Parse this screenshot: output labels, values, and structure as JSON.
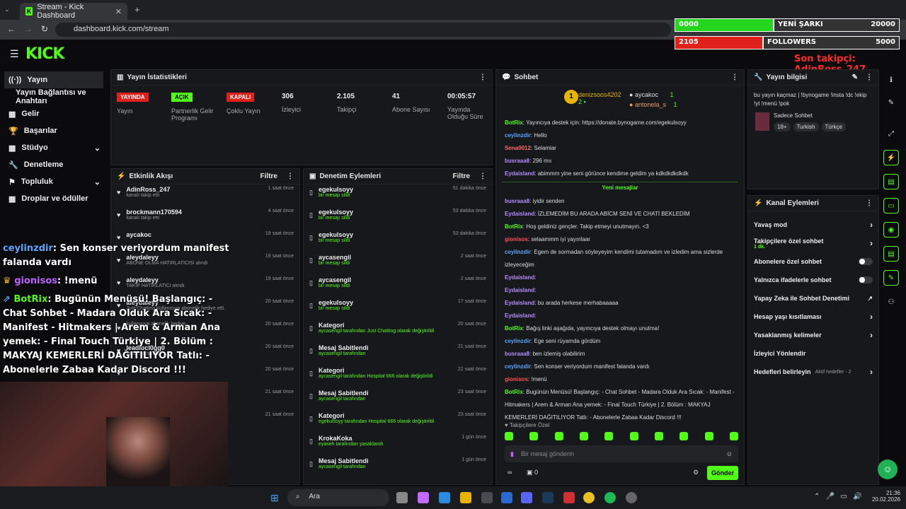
{
  "browser": {
    "tab_title": "Stream - Kick Dashboard",
    "url": "dashboard.kick.com/stream"
  },
  "overlay": {
    "bar1_left": "0000",
    "bar1_mid": "YENİ ŞARKI",
    "bar1_right": "20000",
    "bar2_left": "2105",
    "bar2_mid": "FOLLOWERS",
    "bar2_right": "5000",
    "last_follower": "Son takipçi: AdinRoss_247"
  },
  "brand": {
    "logo": "KICK",
    "accent": "#53fc18"
  },
  "sidebar": {
    "items": [
      {
        "label": "Yayın",
        "icon": "broadcast-icon"
      },
      {
        "label": "Yayın Bağlantısı ve Anahtarı",
        "icon": ""
      },
      {
        "label": "Gelir",
        "icon": "grid-icon"
      },
      {
        "label": "Başarılar",
        "icon": "trophy-icon"
      },
      {
        "label": "Stüdyo",
        "icon": "grid-icon"
      },
      {
        "label": "Denetleme",
        "icon": "wrench-icon"
      },
      {
        "label": "Topluluk",
        "icon": "people-icon"
      },
      {
        "label": "Droplar ve ödüller",
        "icon": "grid-icon"
      }
    ]
  },
  "stats": {
    "title": "Yayın İstatistikleri",
    "live_badge": "YAYINDA",
    "live_label": "Yayın",
    "partner_badge": "AÇIK",
    "partner_label": "Partnerlik Gelir Programı",
    "multi_badge": "KAPALI",
    "multi_label": "Çoklu Yayın",
    "viewers": "306",
    "viewers_label": "İzleyici",
    "followers": "2.105",
    "followers_label": "Takipçi",
    "subs": "41",
    "subs_label": "Abone Sayısı",
    "uptime": "00:05:57",
    "uptime_label": "Yayında Olduğu Süre"
  },
  "activity": {
    "title": "Etkinlik Akışı",
    "filter": "Filtre",
    "rows": [
      {
        "name": "AdinRoss_247",
        "sub": "kanalı takip etti",
        "time": "1 saat önce"
      },
      {
        "name": "brockmann170594",
        "sub": "kanalı takip etti",
        "time": "4 saat önce"
      },
      {
        "name": "aycakoc",
        "sub": "",
        "time": "19 saat önce"
      },
      {
        "name": "aleydaleyy",
        "sub": "ABONE OLMA HATIRLATICISI alındı",
        "time": "19 saat önce"
      },
      {
        "name": "aleydaleyy",
        "sub": "TAKİP HATIRLATICI alındı",
        "time": "19 saat önce"
      },
      {
        "name": "aleydaleyy",
        "sub": "Just Chatting kullanıcıya abonelik hediye etti.",
        "time": "20 saat önce"
      },
      {
        "name": "",
        "sub": "kullanıcıya abonelik hediye",
        "time": "20 saat önce"
      },
      {
        "name": "leadlocl0gg0",
        "sub": "kanalı takip etti",
        "time": "20 saat önce"
      },
      {
        "name": "",
        "sub": "",
        "time": "20 saat önce"
      },
      {
        "name": "",
        "sub": "",
        "time": "21 saat önce"
      },
      {
        "name": "",
        "sub": "",
        "time": "21 saat önce"
      }
    ]
  },
  "moderation": {
    "title": "Denetim Eylemleri",
    "filter": "Filtre",
    "rows": [
      {
        "name": "egekulsoyy",
        "sub": "bir mesajı sildi",
        "time": "51 dakika önce"
      },
      {
        "name": "egekulsoyy",
        "sub": "bir mesajı sildi",
        "time": "53 dakika önce"
      },
      {
        "name": "egekulsoyy",
        "sub": "bir mesajı sildi",
        "time": "53 dakika önce"
      },
      {
        "name": "aycasengil",
        "sub": "bir mesajı sildi",
        "time": "2 saat önce"
      },
      {
        "name": "aycasengil",
        "sub": "bir mesajı sildi",
        "time": "2 saat önce"
      },
      {
        "name": "egekulsoyy",
        "sub": "bir mesajı sildi",
        "time": "17 saat önce"
      },
      {
        "name": "Kategori",
        "sub": "aycasengil tarafından Just Chatting olarak değiştirildi",
        "time": "20 saat önce"
      },
      {
        "name": "Mesaj Sabitlendi",
        "sub": "aycasengil tarafından",
        "time": "21 saat önce"
      },
      {
        "name": "Kategori",
        "sub": "aycasengil tarafından Hospital 666 olarak değiştirildi",
        "time": "21 saat önce"
      },
      {
        "name": "Mesaj Sabitlendi",
        "sub": "aycasengil tarafından",
        "time": "23 saat önce"
      },
      {
        "name": "Kategori",
        "sub": "egekulsoyy tarafından Hospital 666 olarak değiştirildi",
        "time": "23 saat önce"
      },
      {
        "name": "KrokaKoka",
        "sub": "eyaseh tarafından yasaklandı",
        "time": "1 gün önce"
      },
      {
        "name": "Mesaj Sabitlendi",
        "sub": "aycasengil tarafından",
        "time": "1 gün önce"
      }
    ]
  },
  "chat": {
    "title": "Sohbet",
    "top1_name": "denizsoos4202",
    "top1_count": "2",
    "top2_name": "aycakoc",
    "top2_count": "1",
    "top3_name": "antonela_s",
    "top3_count": "1",
    "new_messages": "Yeni mesajlar",
    "messages": [
      {
        "user": "BotRix",
        "color": "#53fc18",
        "text": "Yayıncıya destek için: https://donate.bynogame.com/egekulsoyy"
      },
      {
        "user": "ceylinzdir",
        "color": "#5aa7ff",
        "text": "Hello"
      },
      {
        "user": "Sena0012",
        "color": "#ff6a6a",
        "text": "Selamlar"
      },
      {
        "user": "busraaa8",
        "color": "#b58cff",
        "text": "296 mıı"
      },
      {
        "user": "Eydaisland",
        "color": "#b58cff",
        "text": "abimmm yine seni görünce kendime geldim ya kdkdkdkdkdk"
      },
      {
        "user": "busraaa8",
        "color": "#b58cff",
        "text": "iyidir senden"
      },
      {
        "user": "Eydaisland",
        "color": "#b58cff",
        "text": "İZLEMEDİM BU ARADA ABİCM SENİ VE CHATİ BEKLEDİM"
      },
      {
        "user": "BotRix",
        "color": "#53fc18",
        "text": "Hoş geldiniz gençler. Takip etmeyi unutmayın. <3"
      },
      {
        "user": "gionisos",
        "color": "#ff5050",
        "text": "selaammm iyi yayınlaar"
      },
      {
        "user": "ceylinzdir",
        "color": "#5aa7ff",
        "text": "Egem de sormadan söyleyeyim kendimi tutamadım ve izledim ama sizlerde izleyeceğim"
      },
      {
        "user": "Eydaisland",
        "color": "#b58cff",
        "text": ""
      },
      {
        "user": "Eydaisland",
        "color": "#b58cff",
        "text": ""
      },
      {
        "user": "Eydaisland",
        "color": "#b58cff",
        "text": "bu arada herkese merhabaaaaa"
      },
      {
        "user": "Eydaisland",
        "color": "#b58cff",
        "text": ""
      },
      {
        "user": "BotRix",
        "color": "#53fc18",
        "text": "Bağış linki aşağıda, yayıncıya destek olmayı unutma!"
      },
      {
        "user": "ceylinzdir",
        "color": "#5aa7ff",
        "text": "Ege seni rüyamda gördüm"
      },
      {
        "user": "busraaa8",
        "color": "#b58cff",
        "text": "ben izlemiş olabilirim"
      },
      {
        "user": "ceylinzdir",
        "color": "#5aa7ff",
        "text": "Sen konser veriyordum manifest falanda vardı"
      },
      {
        "user": "gionisos",
        "color": "#ff5050",
        "text": "!menü"
      },
      {
        "user": "BotRix",
        "color": "#53fc18",
        "text": "Bugünün Menüsü! Başlangıç: - Chat Sohbet - Madara Olduk Ara Sıcak: - Manifest - Hitmakers | Arem & Arman Ana yemek: - Final Touch Türkiye | 2. Bölüm : MAKYAJ KEMERLERİ DAĞITILIYOR Tatlı: - Abonelerle Zabaa Kadar Discord !!!"
      }
    ],
    "subs_only": "Takipçilere Özel",
    "input_placeholder": "Bir mesaj gönderin",
    "points": "0",
    "send": "Gönder"
  },
  "streaminfo": {
    "title": "Yayın bilgisi",
    "stream_title": "bu yayın kaçmaz | !bynogame !insta !dc !ekip !yt !menü !pok",
    "category": "Sadece Sohbet",
    "tags": [
      "18+",
      "Turkish",
      "Türkçe"
    ]
  },
  "channel_actions": {
    "title": "Kanal Eylemleri",
    "items": [
      {
        "label": "Yavaş mod",
        "sub": "",
        "kind": "chevron"
      },
      {
        "label": "Takipçilere özel sohbet",
        "sub": "1 dk.",
        "kind": "chevron"
      },
      {
        "label": "Abonelere özel sohbet",
        "sub": "",
        "kind": "toggle"
      },
      {
        "label": "Yalnızca ifadelerle sohbet",
        "sub": "",
        "kind": "toggle"
      },
      {
        "label": "Yapay Zeka ile Sohbet Denetimi",
        "sub": "",
        "kind": "ext"
      },
      {
        "label": "Hesap yaşı kısıtlaması",
        "sub": "",
        "kind": "chevron"
      },
      {
        "label": "Yasaklanmış kelimeler",
        "sub": "",
        "kind": "chevron"
      },
      {
        "label": "İzleyici Yönlendir",
        "sub": "",
        "kind": "none"
      },
      {
        "label": "Hedefleri belirleyin",
        "sub": "Aktif hedefler - 2",
        "kind": "chevron"
      }
    ]
  },
  "stream_overlay_chat": [
    {
      "user": "ceylinzdir",
      "color": "#5aa7ff",
      "text": ": Sen konser veriyordum manifest falanda vardı"
    },
    {
      "user": "gionisos",
      "color": "#ff5050",
      "text": ": !menü"
    },
    {
      "user": "BotRix",
      "color": "#53fc18",
      "text": ": Bugünün Menüsü! Başlangıç: - Chat Sohbet - Madara Olduk Ara Sıcak: - Manifest - Hitmakers | Arem & Arman Ana yemek: - Final Touch Türkiye | 2. Bölüm : MAKYAJ KEMERLERİ DAĞITILIYOR Tatlı: - Abonelerle Zabaa Kadar Discord !!!"
    }
  ],
  "taskbar": {
    "search": "Ara",
    "time": "21:36",
    "date": "20.02.2026"
  }
}
